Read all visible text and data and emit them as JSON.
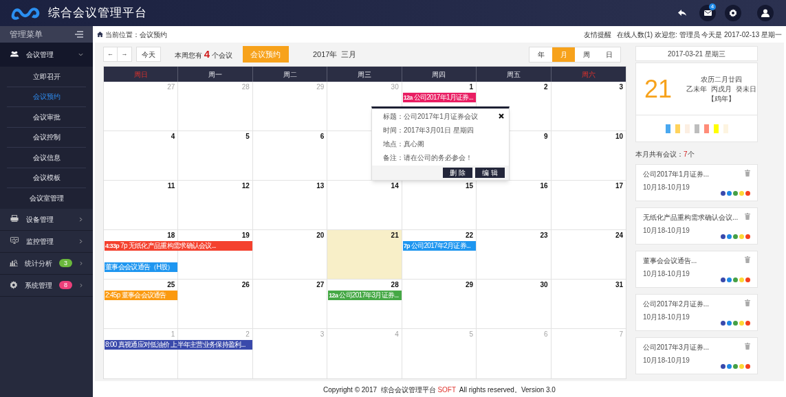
{
  "header": {
    "title": "综合会议管理平台",
    "mail_count": "4"
  },
  "sidebar": {
    "title": "管理菜单",
    "items": [
      {
        "label": "会议管理",
        "selected": true,
        "expanded": true,
        "children": [
          {
            "label": "立即召开",
            "selected": false
          },
          {
            "label": "会议预约",
            "selected": true
          },
          {
            "label": "会议审批",
            "selected": false
          },
          {
            "label": "会议控制",
            "selected": false
          },
          {
            "label": "会议信息",
            "selected": false
          },
          {
            "label": "会议模板",
            "selected": false
          },
          {
            "label": "会议室管理",
            "selected": false
          }
        ]
      },
      {
        "label": "设备管理",
        "selected": false,
        "expanded": false
      },
      {
        "label": "监控管理",
        "selected": false,
        "expanded": false
      },
      {
        "label": "统计分析",
        "selected": false,
        "expanded": false,
        "badge": {
          "text": "3",
          "color": "#6ab83c"
        }
      },
      {
        "label": "系统管理",
        "selected": false,
        "expanded": false,
        "badge": {
          "text": "8",
          "color": "#ec3f7a"
        }
      }
    ]
  },
  "breadcrumb": "当前位置：会议预约",
  "top_info": "友情提醒   在线人数(1) 欢迎您: 管理员 今天是 2017-02-13 星期一",
  "toolbar": {
    "prev": "←",
    "next": "→",
    "today": "今天",
    "week_summary": {
      "before": "本周您有",
      "count": "4",
      "after": "个会议"
    },
    "book_button": "会议预约",
    "month_title": "2017年  三月",
    "views": [
      {
        "label": "年",
        "selected": false
      },
      {
        "label": "月",
        "selected": true
      },
      {
        "label": "周",
        "selected": false
      },
      {
        "label": "日",
        "selected": false
      }
    ]
  },
  "calendar": {
    "weekdays": [
      {
        "label": "周日",
        "weekend": true
      },
      {
        "label": "周一",
        "weekend": false
      },
      {
        "label": "周二",
        "weekend": false
      },
      {
        "label": "周三",
        "weekend": false
      },
      {
        "label": "周四",
        "weekend": false
      },
      {
        "label": "周五",
        "weekend": false
      },
      {
        "label": "周六",
        "weekend": true
      }
    ],
    "weeks": [
      {
        "sun": {
          "day": "27",
          "other_month": true
        },
        "mon": {
          "day": "28",
          "other_month": true
        },
        "tue": {
          "day": "29",
          "other_month": true
        },
        "wed": {
          "day": "30",
          "other_month": true
        },
        "thu": {
          "day": "1",
          "other_month": false,
          "events": [
            {
              "time": "12a",
              "title": "公司2017年1月证券...",
              "color": "#e91e63",
              "continues": false
            }
          ]
        },
        "fri": {
          "day": "2",
          "other_month": false
        },
        "sat": {
          "day": "3",
          "other_month": false
        }
      },
      {
        "sun": {
          "day": "4",
          "other_month": false
        },
        "mon": {
          "day": "5",
          "other_month": false
        },
        "tue": {
          "day": "6",
          "other_month": false
        },
        "fri": {
          "day": "9",
          "other_month": false
        },
        "sat": {
          "day": "10",
          "other_month": false
        }
      },
      {
        "sun": {
          "day": "11",
          "other_month": false
        },
        "mon": {
          "day": "12",
          "other_month": false
        },
        "tue": {
          "day": "13",
          "other_month": false
        },
        "wed": {
          "day": "14",
          "other_month": false
        },
        "thu": {
          "day": "15",
          "other_month": false
        },
        "fri": {
          "day": "16",
          "other_month": false
        },
        "sat": {
          "day": "17",
          "other_month": false
        }
      },
      {
        "sun": {
          "day": "18",
          "other_month": false,
          "events": [
            {
              "time": "4:33p",
              "title": "7p 无纸化产品重构需求确认会议...",
              "color": "#f4412e",
              "continues": true
            },
            {
              "title": "董事会会议通告（H股）",
              "color": "#1e96f0",
              "continues": false
            }
          ]
        },
        "mon": {
          "day": "19",
          "other_month": false
        },
        "tue": {
          "day": "20",
          "other_month": false
        },
        "wed": {
          "day": "21",
          "other_month": false,
          "today": true
        },
        "thu": {
          "day": "22",
          "other_month": false,
          "events": [
            {
              "time": "7p",
              "title": "公司2017年2月证券...",
              "color": "#1e96f0",
              "continues": false
            }
          ]
        },
        "fri": {
          "day": "23",
          "other_month": false
        },
        "sat": {
          "day": "24",
          "other_month": false
        }
      },
      {
        "sun": {
          "day": "25",
          "other_month": false,
          "events": [
            {
              "title": "2:45p 董事会会议通告",
              "color": "#fb9a10",
              "continues": false
            }
          ]
        },
        "mon": {
          "day": "26",
          "other_month": false
        },
        "tue": {
          "day": "27",
          "other_month": false
        },
        "wed": {
          "day": "28",
          "other_month": false,
          "events": [
            {
              "time": "12a",
              "title": "公司2017年3月证券...",
              "color": "#45a845",
              "continues": false
            }
          ]
        },
        "thu": {
          "day": "29",
          "other_month": false
        },
        "fri": {
          "day": "30",
          "other_month": false
        },
        "sat": {
          "day": "31",
          "other_month": false
        }
      },
      {
        "sun": {
          "day": "1",
          "other_month": true,
          "events": [
            {
              "title": "8:00 真视通应对低油价 上半年主营业务保持盈利...",
              "color": "#3949ab",
              "continues": true
            }
          ]
        },
        "mon": {
          "day": "2",
          "other_month": true
        },
        "tue": {
          "day": "3",
          "other_month": true
        },
        "wed": {
          "day": "4",
          "other_month": true
        },
        "thu": {
          "day": "5",
          "other_month": true
        },
        "fri": {
          "day": "6",
          "other_month": true
        },
        "sat": {
          "day": "7",
          "other_month": true
        }
      }
    ]
  },
  "popup": {
    "lines": [
      "标题：公司2017年1月证券会议",
      "时间：2017年3月01日 星期四",
      "地点：真心阁",
      "备注：请在公司的务必参会！"
    ],
    "buttons": [
      "删 除",
      "编 辑"
    ]
  },
  "side_panel": {
    "date": "2017-03-21 星期三",
    "big_day": "21",
    "lunar": [
      "农历二月廿四",
      "乙未年  丙戌月  癸未日",
      "【鸡年】"
    ],
    "swatches": [
      {
        "color": "#4aa8f0"
      },
      {
        "color": "#ffd35c"
      },
      {
        "color": "#fcefe2"
      },
      {
        "color": "#bdbdbd"
      },
      {
        "color": "#ff8c78"
      },
      {
        "color": "#ffff00"
      },
      {
        "color": "#fdf4e0"
      }
    ],
    "count_line": {
      "before": "本月共有会议：",
      "count": "7",
      "after": "个"
    },
    "meetings": [
      {
        "title": "公司2017年1月证券...",
        "dates": "10月18-10月19",
        "dots": [
          {
            "color": "#3949ab"
          },
          {
            "color": "#1e88e5"
          },
          {
            "color": "#43a047"
          },
          {
            "color": "#fdd835"
          },
          {
            "color": "#f4411e"
          }
        ]
      },
      {
        "title": "无纸化产品重构需求确认会议...",
        "dates": "10月18-10月19",
        "dots": [
          {
            "color": "#3949ab"
          },
          {
            "color": "#1e88e5"
          },
          {
            "color": "#43a047"
          },
          {
            "color": "#fdd835"
          },
          {
            "color": "#f4411e"
          }
        ]
      },
      {
        "title": "董事会会议通告...",
        "dates": "10月18-10月19",
        "dots": [
          {
            "color": "#3949ab"
          },
          {
            "color": "#1e88e5"
          },
          {
            "color": "#43a047"
          },
          {
            "color": "#fdd835"
          },
          {
            "color": "#f4411e"
          }
        ]
      },
      {
        "title": "公司2017年2月证券...",
        "dates": "10月18-10月19",
        "dots": [
          {
            "color": "#3949ab"
          },
          {
            "color": "#1e88e5"
          },
          {
            "color": "#43a047"
          },
          {
            "color": "#fdd835"
          },
          {
            "color": "#f4411e"
          }
        ]
      },
      {
        "title": "公司2017年3月证券...",
        "dates": "10月18-10月19",
        "dots": [
          {
            "color": "#3949ab"
          },
          {
            "color": "#1e88e5"
          },
          {
            "color": "#43a047"
          },
          {
            "color": "#fdd835"
          },
          {
            "color": "#f4411e"
          }
        ]
      }
    ]
  },
  "footer": {
    "before": "Copyright © 2017  综合会议管理平台 ",
    "brand": "SOFT",
    "after": "  All rights reserved。Version 3.0"
  }
}
